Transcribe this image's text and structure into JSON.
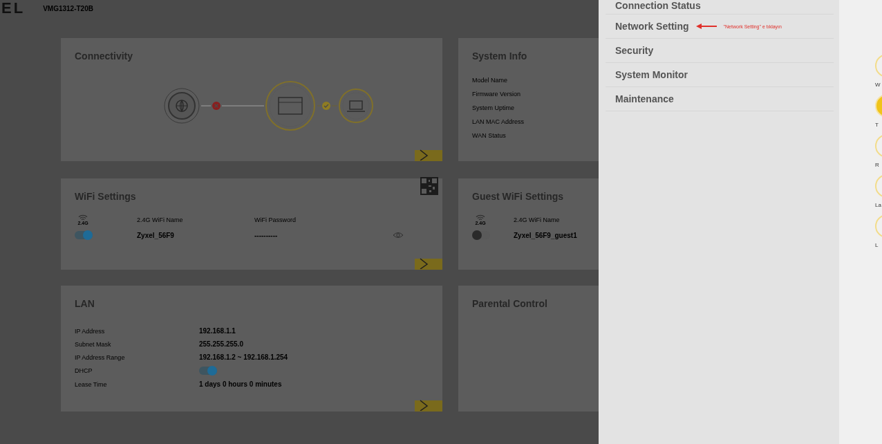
{
  "header": {
    "logo": "EL",
    "model": "VMG1312-T20B"
  },
  "connectivity": {
    "title": "Connectivity",
    "internet_link_ok": false,
    "device_link_ok": true
  },
  "system_info": {
    "title": "System Info",
    "fields": [
      "Model Name",
      "Firmware Version",
      "System Uptime",
      "LAN MAC Address",
      "WAN Status"
    ]
  },
  "wifi": {
    "title": "WiFi Settings",
    "band": "2.4G",
    "name_label": "2.4G WiFi Name",
    "password_label": "WiFi Password",
    "network_name": "Zyxel_56F9",
    "password": "----------",
    "on": true
  },
  "guest_wifi": {
    "title": "Guest WiFi Settings",
    "band": "2.4G",
    "name_label": "2.4G WiFi Name",
    "network_name": "Zyxel_56F9_guest1",
    "on": false
  },
  "lan": {
    "title": "LAN",
    "rows": [
      {
        "kind": "text",
        "label": "IP Address",
        "value": "192.168.1.1"
      },
      {
        "kind": "text",
        "label": "Subnet Mask",
        "value": "255.255.255.0"
      },
      {
        "kind": "text",
        "label": "IP Address Range",
        "value": "192.168.1.2 ~ 192.168.1.254"
      },
      {
        "kind": "toggle",
        "label": "DHCP",
        "on": true
      },
      {
        "kind": "text",
        "label": "Lease Time",
        "value": "1 days 0 hours 0 minutes"
      }
    ]
  },
  "parental_control": {
    "title": "Parental Control"
  },
  "menu": {
    "items": [
      {
        "label": "Connection Status"
      },
      {
        "label": "Network Setting",
        "annotation": "\"Network Setting\" e tıklayın"
      },
      {
        "label": "Security"
      },
      {
        "label": "System Monitor"
      },
      {
        "label": "Maintenance"
      }
    ]
  },
  "rail": {
    "items": [
      {
        "label": "W",
        "filled": false
      },
      {
        "label": "T",
        "filled": true
      },
      {
        "label": "R",
        "filled": false
      },
      {
        "label": "La",
        "filled": false
      },
      {
        "label": "L",
        "filled": false
      }
    ]
  }
}
